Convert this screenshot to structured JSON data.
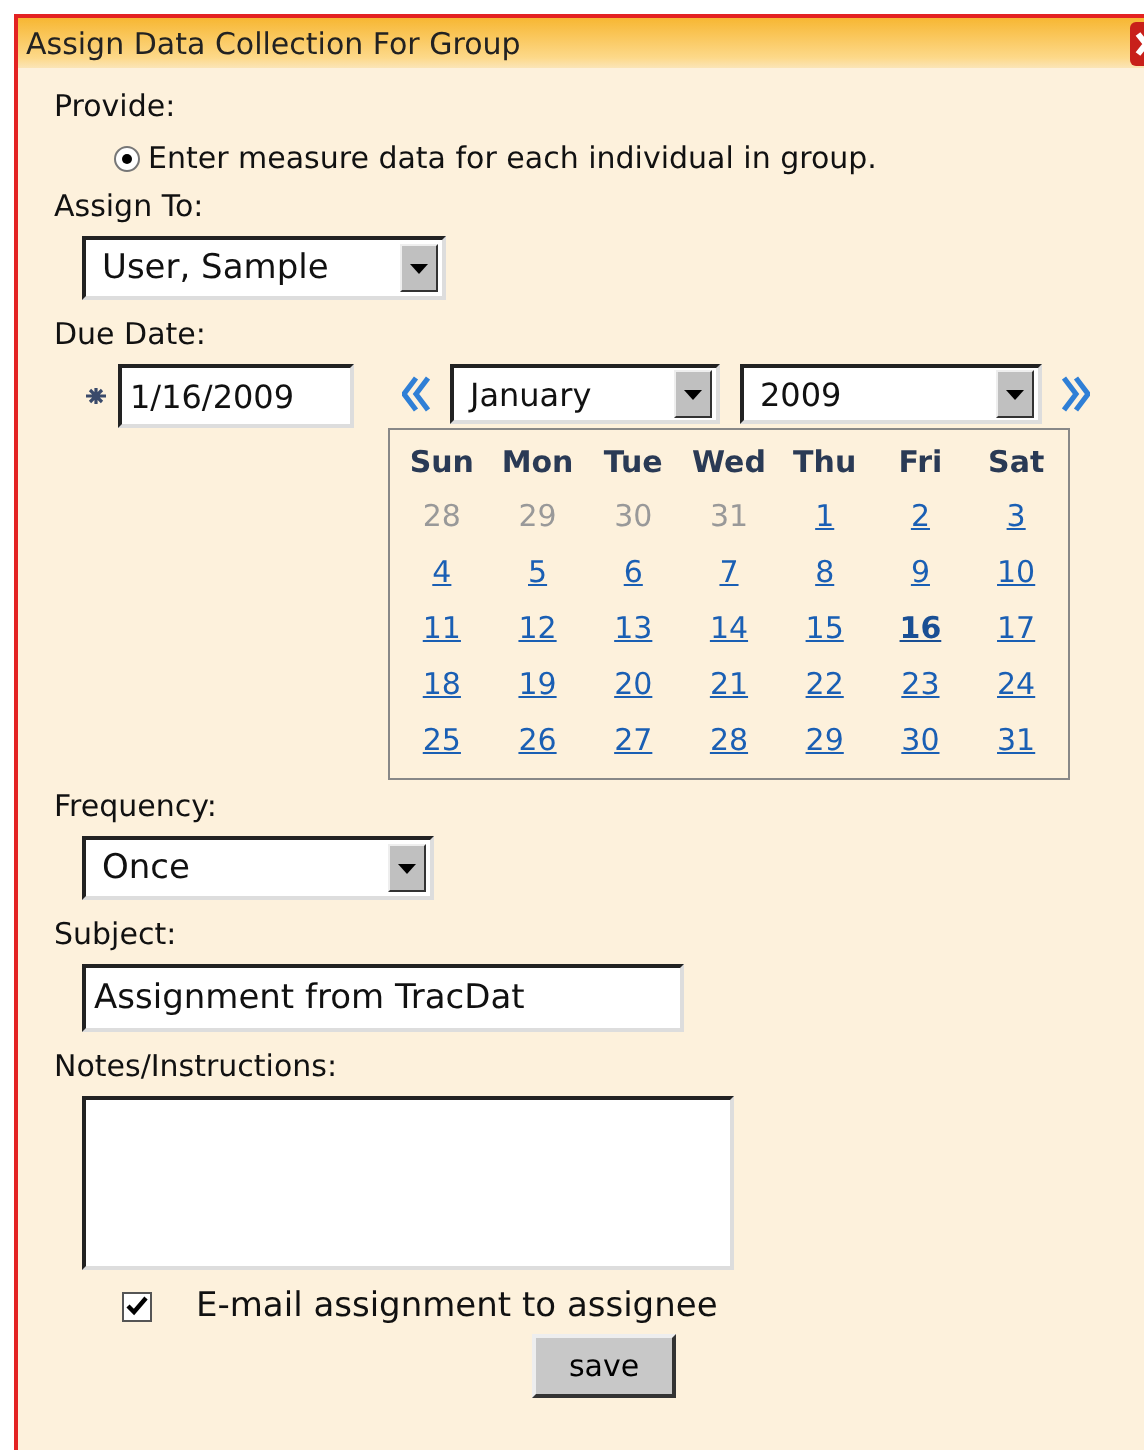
{
  "window": {
    "title": "Assign Data Collection For Group"
  },
  "provide": {
    "label": "Provide:",
    "option": {
      "label": "Enter measure data for each individual in group.",
      "selected": true
    }
  },
  "assign_to": {
    "label": "Assign To:",
    "value": "User, Sample"
  },
  "due_date": {
    "label": "Due Date:",
    "value": "1/16/2009",
    "month": "January",
    "year": "2009",
    "weekdays": [
      "Sun",
      "Mon",
      "Tue",
      "Wed",
      "Thu",
      "Fri",
      "Sat"
    ],
    "days": [
      {
        "label": "28",
        "other_month": true,
        "selected": false
      },
      {
        "label": "29",
        "other_month": true,
        "selected": false
      },
      {
        "label": "30",
        "other_month": true,
        "selected": false
      },
      {
        "label": "31",
        "other_month": true,
        "selected": false
      },
      {
        "label": "1",
        "other_month": false,
        "selected": false
      },
      {
        "label": "2",
        "other_month": false,
        "selected": false
      },
      {
        "label": "3",
        "other_month": false,
        "selected": false
      },
      {
        "label": "4",
        "other_month": false,
        "selected": false
      },
      {
        "label": "5",
        "other_month": false,
        "selected": false
      },
      {
        "label": "6",
        "other_month": false,
        "selected": false
      },
      {
        "label": "7",
        "other_month": false,
        "selected": false
      },
      {
        "label": "8",
        "other_month": false,
        "selected": false
      },
      {
        "label": "9",
        "other_month": false,
        "selected": false
      },
      {
        "label": "10",
        "other_month": false,
        "selected": false
      },
      {
        "label": "11",
        "other_month": false,
        "selected": false
      },
      {
        "label": "12",
        "other_month": false,
        "selected": false
      },
      {
        "label": "13",
        "other_month": false,
        "selected": false
      },
      {
        "label": "14",
        "other_month": false,
        "selected": false
      },
      {
        "label": "15",
        "other_month": false,
        "selected": false
      },
      {
        "label": "16",
        "other_month": false,
        "selected": true
      },
      {
        "label": "17",
        "other_month": false,
        "selected": false
      },
      {
        "label": "18",
        "other_month": false,
        "selected": false
      },
      {
        "label": "19",
        "other_month": false,
        "selected": false
      },
      {
        "label": "20",
        "other_month": false,
        "selected": false
      },
      {
        "label": "21",
        "other_month": false,
        "selected": false
      },
      {
        "label": "22",
        "other_month": false,
        "selected": false
      },
      {
        "label": "23",
        "other_month": false,
        "selected": false
      },
      {
        "label": "24",
        "other_month": false,
        "selected": false
      },
      {
        "label": "25",
        "other_month": false,
        "selected": false
      },
      {
        "label": "26",
        "other_month": false,
        "selected": false
      },
      {
        "label": "27",
        "other_month": false,
        "selected": false
      },
      {
        "label": "28",
        "other_month": false,
        "selected": false
      },
      {
        "label": "29",
        "other_month": false,
        "selected": false
      },
      {
        "label": "30",
        "other_month": false,
        "selected": false
      },
      {
        "label": "31",
        "other_month": false,
        "selected": false
      }
    ]
  },
  "frequency": {
    "label": "Frequency:",
    "value": "Once"
  },
  "subject": {
    "label": "Subject:",
    "value": "Assignment from TracDat"
  },
  "notes": {
    "label": "Notes/Instructions:"
  },
  "email": {
    "label": "E-mail assignment to assignee",
    "checked": true
  },
  "buttons": [
    "save"
  ]
}
